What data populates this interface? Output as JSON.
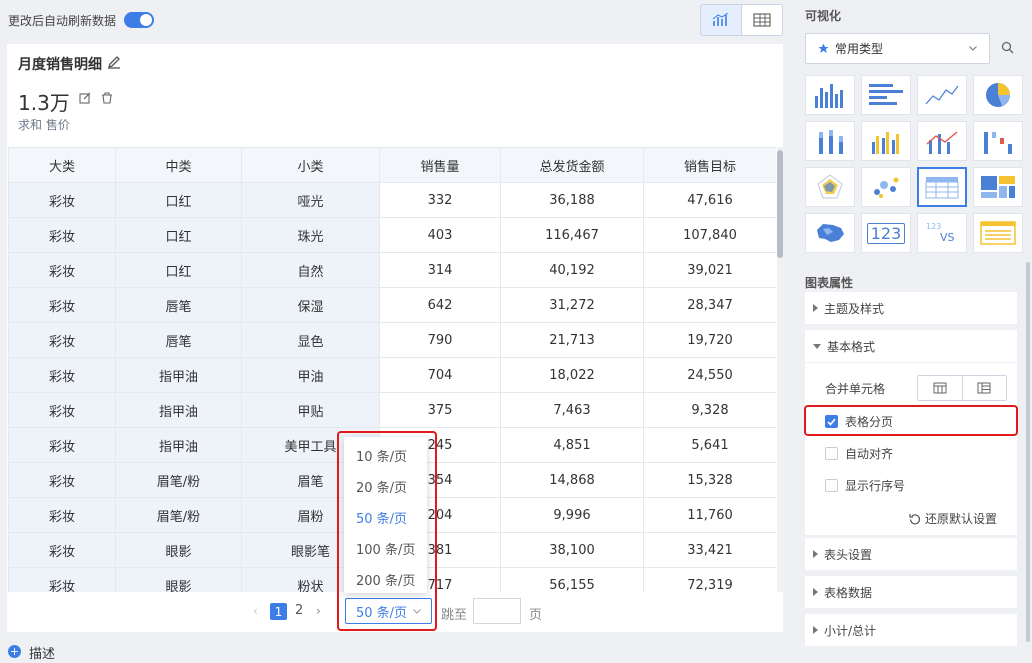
{
  "topbar": {
    "auto_refresh_label": "更改后自动刷新数据"
  },
  "card": {
    "title": "月度销售明细",
    "value": "1.3万",
    "sub_label": "求和 售价"
  },
  "table": {
    "headers": [
      "大类",
      "中类",
      "小类",
      "销售量",
      "总发货金额",
      "销售目标"
    ],
    "rows": [
      [
        "彩妆",
        "口红",
        "哑光",
        "332",
        "36,188",
        "47,616"
      ],
      [
        "彩妆",
        "口红",
        "珠光",
        "403",
        "116,467",
        "107,840"
      ],
      [
        "彩妆",
        "口红",
        "自然",
        "314",
        "40,192",
        "39,021"
      ],
      [
        "彩妆",
        "唇笔",
        "保湿",
        "642",
        "31,272",
        "28,347"
      ],
      [
        "彩妆",
        "唇笔",
        "显色",
        "790",
        "21,713",
        "19,720"
      ],
      [
        "彩妆",
        "指甲油",
        "甲油",
        "704",
        "18,022",
        "24,550"
      ],
      [
        "彩妆",
        "指甲油",
        "甲贴",
        "375",
        "7,463",
        "9,328"
      ],
      [
        "彩妆",
        "指甲油",
        "美甲工具",
        "245",
        "4,851",
        "5,641"
      ],
      [
        "彩妆",
        "眉笔/粉",
        "眉笔",
        "354",
        "14,868",
        "15,328"
      ],
      [
        "彩妆",
        "眉笔/粉",
        "眉粉",
        "204",
        "9,996",
        "11,760"
      ],
      [
        "彩妆",
        "眼影",
        "眼影笔",
        "381",
        "38,100",
        "33,421"
      ],
      [
        "彩妆",
        "眼影",
        "粉状",
        "717",
        "56,155",
        "72,319"
      ]
    ]
  },
  "pagination": {
    "prev": "‹",
    "pages": [
      "1",
      "2"
    ],
    "next": "›",
    "page_size": "50 条/页",
    "jump_label": "跳至",
    "page_suffix": "页",
    "options": [
      "10 条/页",
      "20 条/页",
      "50 条/页",
      "100 条/页",
      "200 条/页"
    ]
  },
  "describe_label": "描述",
  "right": {
    "title": "可视化",
    "type_select": "常用类型",
    "chart_tiles": [
      "column-chart-icon",
      "bar-chart-icon",
      "line-chart-icon",
      "pie-chart-icon",
      "stacked-column-icon",
      "multi-column-icon",
      "combo-chart-icon",
      "waterfall-chart-icon",
      "radar-chart-icon",
      "scatter-chart-icon",
      "table-chart-icon",
      "treemap-chart-icon",
      "map-chart-icon",
      "kpi-123-icon",
      "kpi-compare-icon",
      "card-list-icon"
    ],
    "kpi_text": "123",
    "kpi_small": "123",
    "kpi_vs": "VS",
    "props_title": "图表属性",
    "sections": {
      "theme": "主题及样式",
      "basic": "基本格式",
      "header": "表头设置",
      "data": "表格数据",
      "subtotal": "小计/总计"
    },
    "merge_label": "合并单元格",
    "opt_paging": "表格分页",
    "opt_align": "自动对齐",
    "opt_rownum": "显示行序号",
    "restore": "还原默认设置"
  },
  "colors": {
    "accent": "#3d7ee6",
    "highlight": "#e21a1a"
  }
}
